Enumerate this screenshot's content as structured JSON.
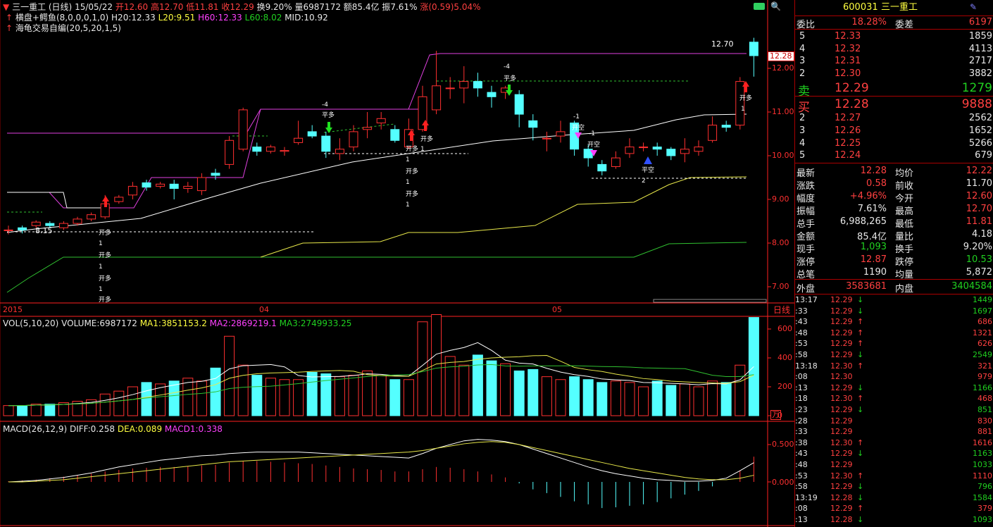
{
  "header": {
    "name": "三一重工 (日线)",
    "date": "15/05/22",
    "open": "开12.60",
    "high": "高12.70",
    "low": "低11.81",
    "close": "收12.29",
    "turnover": "换9.20%",
    "volume": "量6987172",
    "amount": "额85.4亿",
    "amplitude": "振7.61%",
    "change": "涨(0.59)5.04%"
  },
  "indicators": {
    "line1_name": "横盘+鳄鱼(8,0,0,0,1,0)",
    "h20": "H20:12.33",
    "l20": "L20:9.51",
    "h60": "H60:12.33",
    "l60": "L60:8.02",
    "mid": "MID:10.92",
    "line2_name": "海龟交易自编(20,5,20,1,5)"
  },
  "price_axis": [
    "12.00",
    "11.00",
    "10.00",
    "9.00",
    "8.00",
    "7.00"
  ],
  "current_price_tag": "12.28",
  "annotations": {
    "max_label": "12.70",
    "min_label": "8.15",
    "kai_duo": "开多",
    "ping_duo": "平多",
    "kai_kong": "开空",
    "ping_kong": "平空",
    "neg4": "-4",
    "neg1": "-1",
    "one": "1",
    "two": "2"
  },
  "time_axis": [
    "2015",
    "04",
    "05"
  ],
  "period_label": "日线",
  "volume_panel": {
    "label": "VOL(5,10,20)",
    "volume": "VOLUME:6987172",
    "ma1": "MA1:3851153.2",
    "ma2": "MA2:2869219.1",
    "ma3": "MA3:2749933.25",
    "axis": [
      "600",
      "400",
      "200",
      "0"
    ],
    "unit": "万"
  },
  "macd_panel": {
    "label": "MACD(26,12,9)",
    "diff": "DIFF:0.258",
    "dea": "DEA:0.089",
    "macd1": "MACD1:0.338",
    "axis": [
      "0.500",
      "0.000"
    ]
  },
  "quote": {
    "code": "600031",
    "name": "三一重工",
    "webi_label": "委比",
    "webi": "18.28%",
    "weicha_label": "委差",
    "weicha": "6197",
    "sell": [
      {
        "lvl": "5",
        "price": "12.33",
        "vol": "1859"
      },
      {
        "lvl": "4",
        "price": "12.32",
        "vol": "4113"
      },
      {
        "lvl": "3",
        "price": "12.31",
        "vol": "2717"
      },
      {
        "lvl": "2",
        "price": "12.30",
        "vol": "3882"
      }
    ],
    "sell1_label": "卖",
    "sell1_price": "12.29",
    "sell1_vol": "1279",
    "buy1_label": "买",
    "buy1_price": "12.28",
    "buy1_vol": "9888",
    "buy": [
      {
        "lvl": "2",
        "price": "12.27",
        "vol": "2562"
      },
      {
        "lvl": "3",
        "price": "12.26",
        "vol": "1652"
      },
      {
        "lvl": "4",
        "price": "12.25",
        "vol": "5266"
      },
      {
        "lvl": "5",
        "price": "12.24",
        "vol": "679"
      }
    ],
    "stats": [
      {
        "k1": "最新",
        "v1": "12.28",
        "c1": "red",
        "k2": "均价",
        "v2": "12.22",
        "c2": "red"
      },
      {
        "k1": "涨跌",
        "v1": "0.58",
        "c1": "red",
        "k2": "前收",
        "v2": "11.70",
        "c2": "white"
      },
      {
        "k1": "幅度",
        "v1": "+4.96%",
        "c1": "red",
        "k2": "今开",
        "v2": "12.60",
        "c2": "red"
      },
      {
        "k1": "振幅",
        "v1": "7.61%",
        "c1": "white",
        "k2": "最高",
        "v2": "12.70",
        "c2": "red"
      },
      {
        "k1": "总手",
        "v1": "6,988,265",
        "c1": "white",
        "k2": "最低",
        "v2": "11.81",
        "c2": "red"
      },
      {
        "k1": "金额",
        "v1": "85.4亿",
        "c1": "white",
        "k2": "量比",
        "v2": "4.18",
        "c2": "white"
      },
      {
        "k1": "现手",
        "v1": "1,093",
        "c1": "green",
        "k2": "换手",
        "v2": "9.20%",
        "c2": "white"
      },
      {
        "k1": "涨停",
        "v1": "12.87",
        "c1": "red",
        "k2": "跌停",
        "v2": "10.53",
        "c2": "green"
      },
      {
        "k1": "总笔",
        "v1": "1190",
        "c1": "white",
        "k2": "均量",
        "v2": "5,872",
        "c2": "white"
      }
    ],
    "waipan_label": "外盘",
    "waipan": "3583681",
    "neipan_label": "内盘",
    "neipan": "3404584"
  },
  "ticks": [
    {
      "t": "13:17",
      "p": "12.29",
      "d": "down",
      "v": "1449",
      "vc": "green"
    },
    {
      "t": ":33",
      "p": "12.29",
      "d": "down",
      "v": "1697",
      "vc": "green"
    },
    {
      "t": ":43",
      "p": "12.29",
      "d": "up",
      "v": "686",
      "vc": "red"
    },
    {
      "t": ":48",
      "p": "12.29",
      "d": "up",
      "v": "1321",
      "vc": "red"
    },
    {
      "t": ":53",
      "p": "12.29",
      "d": "up",
      "v": "626",
      "vc": "red"
    },
    {
      "t": ":58",
      "p": "12.29",
      "d": "down",
      "v": "2549",
      "vc": "green"
    },
    {
      "t": "13:18",
      "p": "12.30",
      "d": "up",
      "v": "321",
      "vc": "red"
    },
    {
      "t": ":08",
      "p": "12.30",
      "d": "",
      "v": "979",
      "vc": "red"
    },
    {
      "t": ":13",
      "p": "12.29",
      "d": "down",
      "v": "1166",
      "vc": "green"
    },
    {
      "t": ":18",
      "p": "12.30",
      "d": "up",
      "v": "468",
      "vc": "red"
    },
    {
      "t": ":23",
      "p": "12.29",
      "d": "down",
      "v": "851",
      "vc": "green"
    },
    {
      "t": ":28",
      "p": "12.29",
      "d": "",
      "v": "830",
      "vc": "red"
    },
    {
      "t": ":33",
      "p": "12.29",
      "d": "",
      "v": "881",
      "vc": "red"
    },
    {
      "t": ":38",
      "p": "12.30",
      "d": "up",
      "v": "1616",
      "vc": "red"
    },
    {
      "t": ":43",
      "p": "12.29",
      "d": "down",
      "v": "1163",
      "vc": "green"
    },
    {
      "t": ":48",
      "p": "12.29",
      "d": "",
      "v": "1033",
      "vc": "green"
    },
    {
      "t": ":53",
      "p": "12.30",
      "d": "up",
      "v": "1110",
      "vc": "red"
    },
    {
      "t": ":58",
      "p": "12.29",
      "d": "down",
      "v": "796",
      "vc": "green"
    },
    {
      "t": "13:19",
      "p": "12.28",
      "d": "down",
      "v": "1584",
      "vc": "green"
    },
    {
      "t": ":08",
      "p": "12.29",
      "d": "up",
      "v": "379",
      "vc": "red"
    },
    {
      "t": ":13",
      "p": "12.28",
      "d": "down",
      "v": "1093",
      "vc": "green"
    }
  ],
  "candles": [
    [
      8.3,
      8.3,
      8.4,
      8.2
    ],
    [
      8.35,
      8.3,
      8.4,
      8.22
    ],
    [
      8.4,
      8.48,
      8.52,
      8.35
    ],
    [
      8.45,
      8.4,
      8.5,
      8.35
    ],
    [
      8.35,
      8.45,
      8.5,
      8.3
    ],
    [
      8.45,
      8.55,
      8.6,
      8.4
    ],
    [
      8.55,
      8.65,
      8.7,
      8.5
    ],
    [
      8.6,
      8.9,
      9.1,
      8.55
    ],
    [
      8.95,
      9.05,
      9.1,
      8.9
    ],
    [
      9.1,
      9.3,
      9.4,
      9.0
    ],
    [
      9.38,
      9.28,
      9.45,
      9.2
    ],
    [
      9.3,
      9.35,
      9.4,
      9.25
    ],
    [
      9.35,
      9.25,
      9.45,
      9.0
    ],
    [
      9.25,
      9.3,
      9.4,
      9.15
    ],
    [
      9.2,
      9.5,
      9.6,
      9.1
    ],
    [
      9.6,
      9.55,
      9.7,
      9.45
    ],
    [
      9.8,
      10.35,
      10.45,
      9.7
    ],
    [
      10.15,
      11.05,
      11.1,
      10.1
    ],
    [
      10.2,
      10.1,
      10.3,
      10.0
    ],
    [
      10.1,
      10.2,
      10.25,
      10.05
    ],
    [
      10.1,
      10.12,
      10.2,
      10.0
    ],
    [
      10.3,
      10.4,
      10.8,
      10.25
    ],
    [
      10.55,
      10.45,
      10.7,
      10.4
    ],
    [
      10.45,
      10.1,
      10.55,
      9.95
    ],
    [
      10.05,
      10.15,
      10.4,
      9.9
    ],
    [
      10.2,
      10.55,
      10.7,
      10.1
    ],
    [
      10.6,
      10.65,
      11.0,
      10.4
    ],
    [
      10.75,
      10.85,
      11.0,
      10.6
    ],
    [
      10.6,
      10.35,
      10.7,
      10.3
    ],
    [
      10.2,
      10.6,
      10.85,
      10.15
    ],
    [
      10.6,
      11.35,
      11.6,
      10.55
    ],
    [
      11.05,
      11.6,
      12.4,
      10.95
    ],
    [
      11.55,
      11.55,
      11.8,
      11.3
    ],
    [
      11.55,
      11.7,
      12.05,
      11.2
    ],
    [
      11.7,
      11.55,
      11.9,
      11.35
    ],
    [
      11.45,
      11.35,
      11.6,
      11.1
    ],
    [
      11.45,
      11.55,
      11.6,
      11.3
    ],
    [
      11.4,
      10.95,
      11.5,
      10.65
    ],
    [
      10.8,
      10.65,
      10.95,
      10.35
    ],
    [
      10.4,
      10.4,
      10.55,
      10.1
    ],
    [
      10.45,
      10.55,
      10.8,
      10.3
    ],
    [
      10.75,
      10.15,
      10.8,
      10.0
    ],
    [
      10.15,
      9.95,
      10.25,
      9.75
    ],
    [
      9.8,
      9.65,
      9.9,
      9.55
    ],
    [
      9.75,
      9.95,
      10.1,
      9.7
    ],
    [
      10.05,
      10.2,
      10.4,
      9.95
    ],
    [
      10.2,
      10.2,
      10.3,
      10.1
    ],
    [
      10.2,
      10.15,
      10.3,
      10.0
    ],
    [
      10.15,
      10.0,
      10.2,
      9.9
    ],
    [
      10.05,
      10.15,
      10.4,
      9.85
    ],
    [
      10.1,
      10.2,
      10.35,
      10.0
    ],
    [
      10.35,
      10.7,
      10.9,
      10.3
    ],
    [
      10.7,
      10.65,
      10.8,
      10.55
    ],
    [
      10.7,
      11.7,
      11.8,
      10.6
    ],
    [
      12.6,
      12.29,
      12.7,
      11.81
    ]
  ],
  "volumes": [
    70,
    70,
    80,
    80,
    90,
    100,
    110,
    150,
    170,
    200,
    230,
    220,
    240,
    260,
    240,
    330,
    550,
    350,
    280,
    260,
    250,
    250,
    300,
    290,
    270,
    280,
    310,
    280,
    250,
    250,
    650,
    700,
    410,
    350,
    420,
    380,
    360,
    310,
    320,
    270,
    250,
    270,
    250,
    230,
    240,
    230,
    200,
    240,
    210,
    220,
    200,
    240,
    230,
    350,
    680
  ],
  "macd_bars": [
    0.01,
    0.02,
    0.03,
    0.05,
    0.07,
    0.09,
    0.11,
    0.14,
    0.16,
    0.18,
    0.19,
    0.2,
    0.2,
    0.21,
    0.22,
    0.23,
    0.26,
    0.28,
    0.28,
    0.27,
    0.26,
    0.25,
    0.24,
    0.22,
    0.2,
    0.18,
    0.17,
    0.16,
    0.14,
    0.14,
    0.17,
    0.2,
    0.19,
    0.17,
    0.14,
    0.1,
    0.06,
    -0.02,
    -0.1,
    -0.15,
    -0.2,
    -0.26,
    -0.3,
    -0.35,
    -0.34,
    -0.32,
    -0.3,
    -0.27,
    -0.22,
    -0.17,
    -0.12,
    -0.06,
    0.0,
    0.15,
    0.338
  ],
  "colors": {
    "up": "#ff3030",
    "down": "#54ffff",
    "grid": "#8b0000",
    "axis": "#ff2020",
    "ma_white": "#ffffff",
    "ma_yellow": "#e8e84a",
    "ma_green": "#30c030",
    "ma_magenta": "#e040e0"
  }
}
